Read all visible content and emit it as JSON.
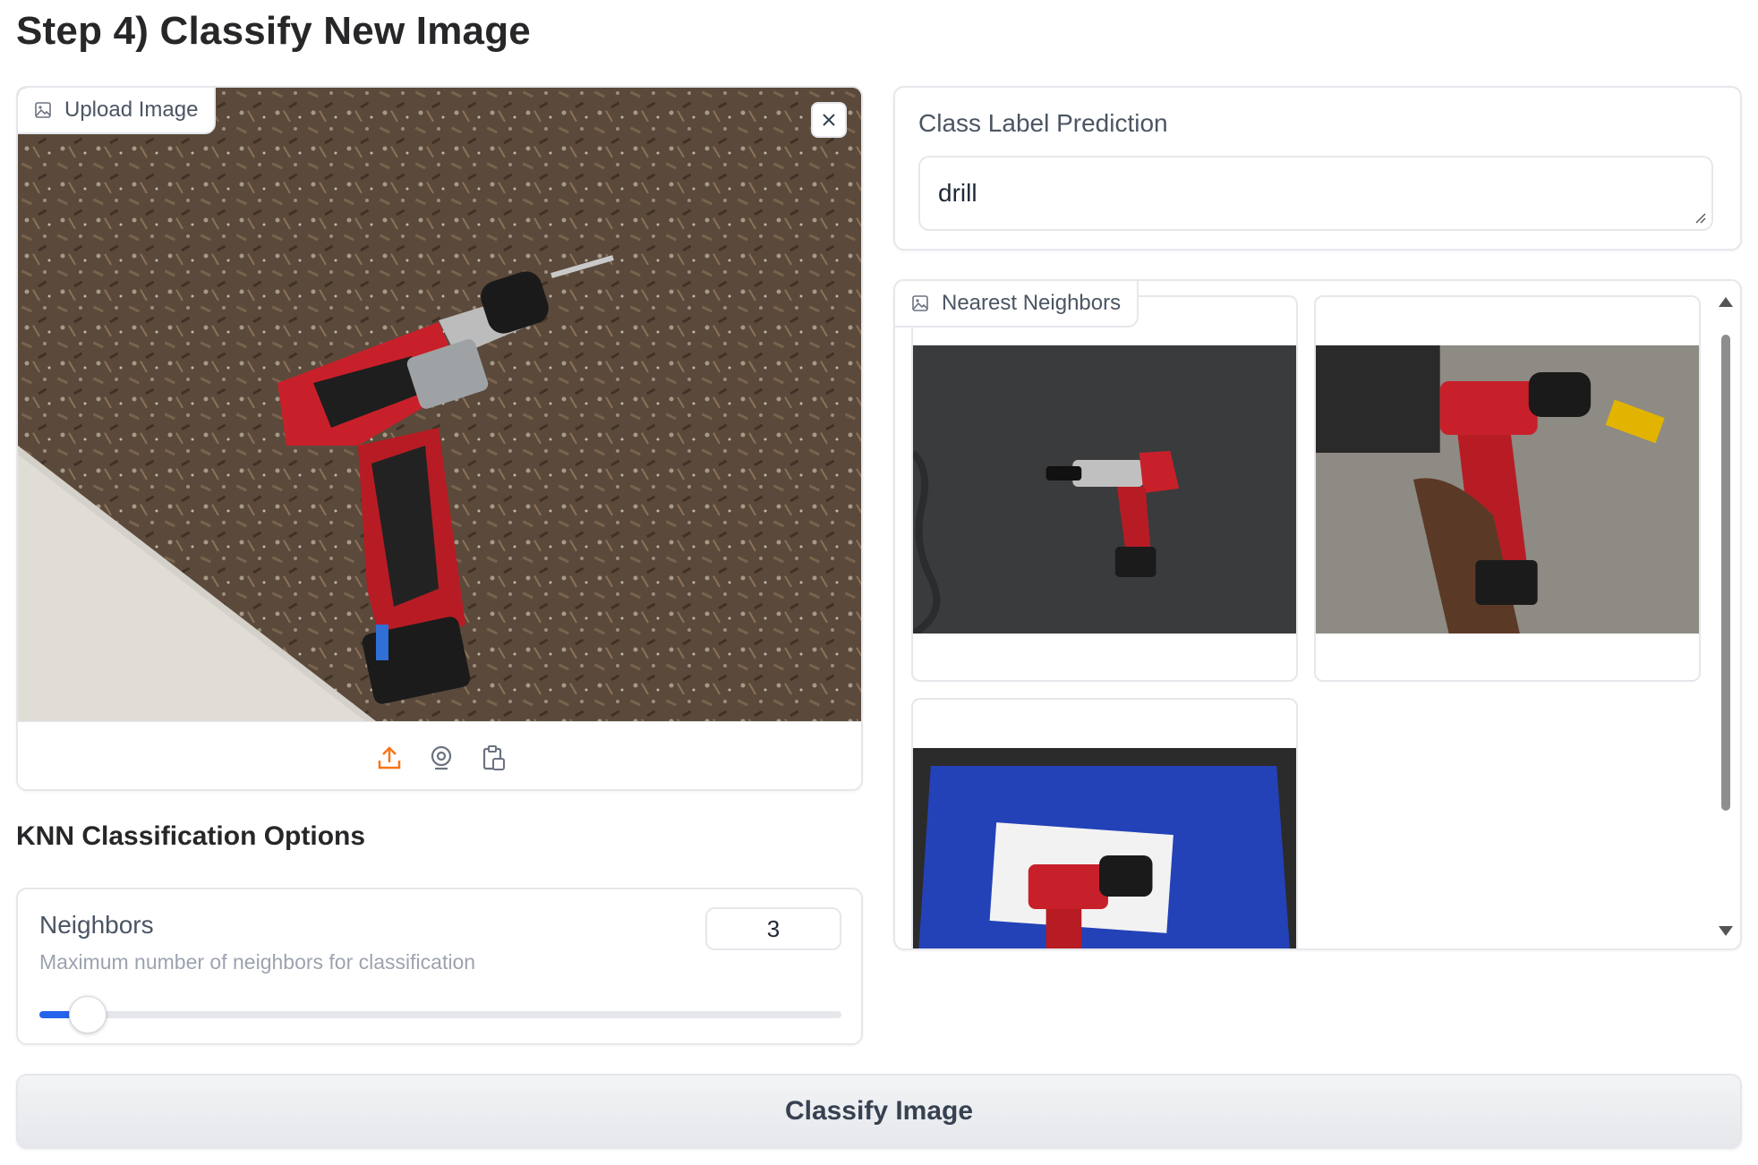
{
  "page": {
    "title": "Step 4) Classify New Image"
  },
  "upload": {
    "label": "Upload Image",
    "icon": "image-icon",
    "sources": [
      "upload-icon",
      "webcam-icon",
      "clipboard-icon"
    ],
    "accent_color": "#f97316"
  },
  "options": {
    "title": "KNN Classification Options",
    "neighbors": {
      "label": "Neighbors",
      "info": "Maximum number of neighbors for classification",
      "value": "3",
      "slider_fraction": 0.06
    }
  },
  "prediction": {
    "label": "Class Label Prediction",
    "value": "drill"
  },
  "gallery": {
    "label": "Nearest Neighbors",
    "icon": "image-icon",
    "items": 3
  },
  "actions": {
    "classify_label": "Classify Image"
  },
  "colors": {
    "slider_fill": "#2563eb",
    "border": "#e5e7eb"
  }
}
